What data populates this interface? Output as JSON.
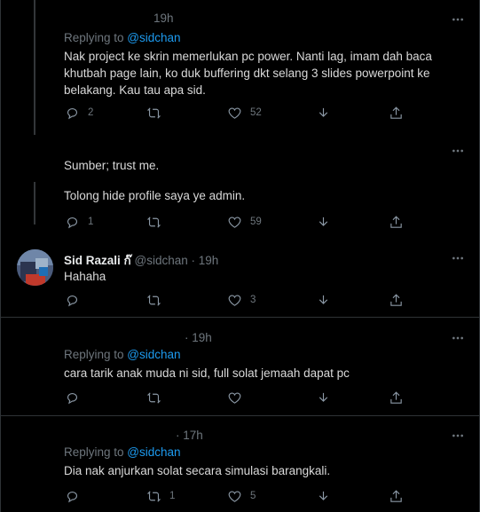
{
  "tweets": [
    {
      "time": "19h",
      "replying_prefix": "Replying to ",
      "replying_handle": "@sidchan",
      "text": "Nak project ke skrin memerlukan pc power. Nanti lag, imam dah baca khutbah page lain, ko duk buffering dkt selang 3 slides powerpoint ke belakang. Kau tau apa sid.",
      "reply_count": "2",
      "retweet_count": "",
      "like_count": "52"
    },
    {
      "text_1": "Sumber; trust me.",
      "text_2": "Tolong hide profile saya ye admin.",
      "reply_count": "1",
      "retweet_count": "",
      "like_count": "59"
    },
    {
      "name": "Sid Razali",
      "name_suffix": "ก๊",
      "handle_time": "@sidchan · 19h",
      "text": "Hahaha",
      "reply_count": "",
      "retweet_count": "",
      "like_count": "3"
    },
    {
      "time": "· 19h",
      "replying_prefix": "Replying to ",
      "replying_handle": "@sidchan",
      "text": "cara tarik anak muda ni sid, full solat jemaah dapat pc",
      "reply_count": "",
      "retweet_count": "",
      "like_count": ""
    },
    {
      "time": "· 17h",
      "replying_prefix": "Replying to ",
      "replying_handle": "@sidchan",
      "text": "Dia nak anjurkan solat secara simulasi barangkali.",
      "reply_count": "",
      "retweet_count": "1",
      "like_count": "5"
    }
  ],
  "colors": {
    "background": "#000000",
    "text": "#d9d9d9",
    "muted": "#6e767d",
    "link": "#1d9bf0",
    "divider": "#2f3336"
  },
  "icons": [
    "more-icon",
    "reply-icon",
    "retweet-icon",
    "like-icon",
    "download-icon",
    "share-icon"
  ]
}
